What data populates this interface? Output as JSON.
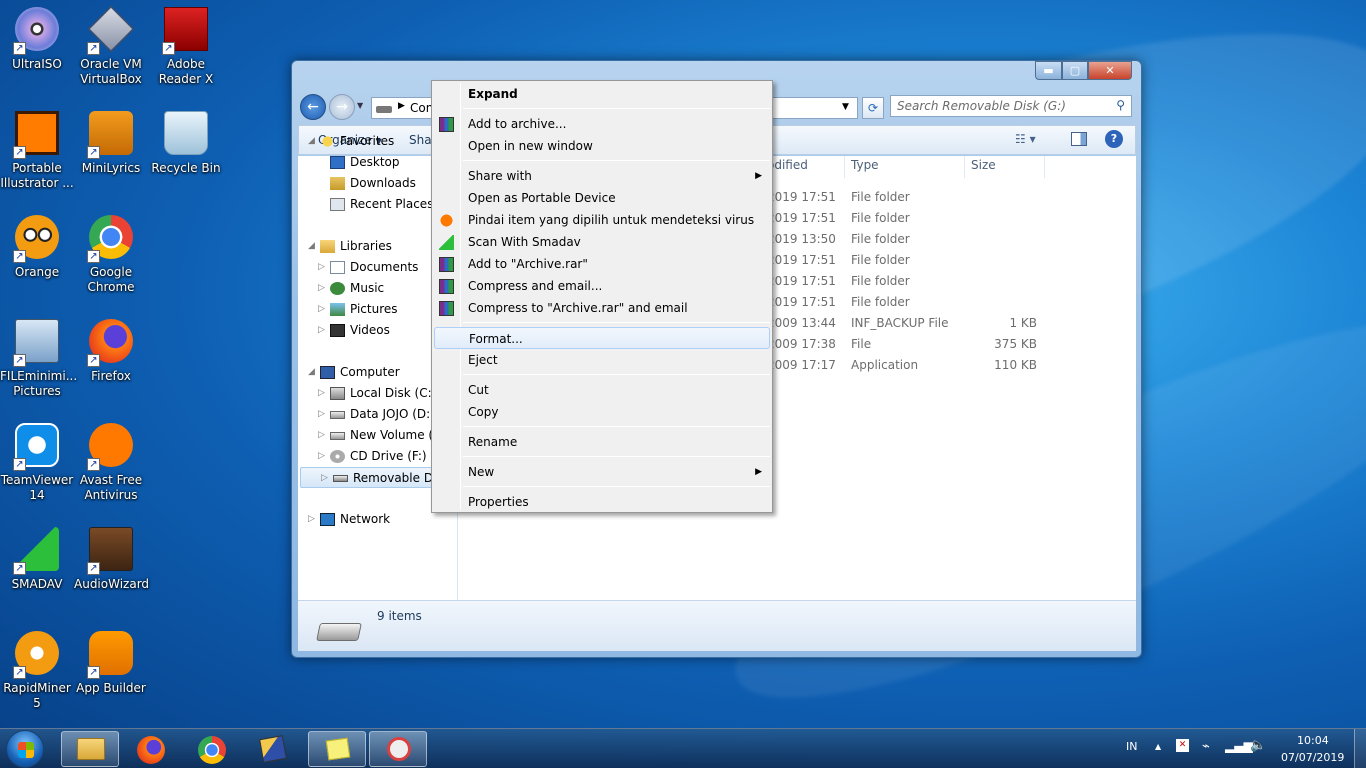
{
  "desktop": {
    "icons": [
      {
        "label": "UltraISO",
        "icon": "ultraiso-disc-icon"
      },
      {
        "label": "Oracle VM VirtualBox",
        "icon": "virtualbox-icon"
      },
      {
        "label": "Adobe Reader X",
        "icon": "adobe-reader-icon"
      },
      {
        "label": "Portable Illustrator ...",
        "icon": "illustrator-icon"
      },
      {
        "label": "MiniLyrics",
        "icon": "minilyrics-icon"
      },
      {
        "label": "Recycle Bin",
        "icon": "recycle-bin-icon"
      },
      {
        "label": "Orange",
        "icon": "orange-app-icon"
      },
      {
        "label": "Google Chrome",
        "icon": "chrome-icon"
      },
      {
        "label": "FILEminimi... Pictures",
        "icon": "fileminimizer-icon"
      },
      {
        "label": "Firefox",
        "icon": "firefox-icon"
      },
      {
        "label": "TeamViewer 14",
        "icon": "teamviewer-icon"
      },
      {
        "label": "Avast Free Antivirus",
        "icon": "avast-icon"
      },
      {
        "label": "SMADAV",
        "icon": "smadav-icon"
      },
      {
        "label": "AudioWizard",
        "icon": "audiowizard-icon"
      },
      {
        "label": "RapidMiner 5",
        "icon": "rapidminer-icon"
      },
      {
        "label": "App Builder",
        "icon": "app-builder-icon"
      }
    ]
  },
  "explorer": {
    "address_visible": "Com",
    "search_placeholder": "Search Removable Disk (G:)",
    "toolbar": {
      "organize": "Organize",
      "share": "Share"
    },
    "nav": [
      {
        "label": "Favorites",
        "icon": "star-icon",
        "level": 0,
        "expander": "open"
      },
      {
        "label": "Desktop",
        "icon": "desktop-icon",
        "level": 1
      },
      {
        "label": "Downloads",
        "icon": "downloads-icon",
        "level": 1
      },
      {
        "label": "Recent Places",
        "icon": "recent-places-icon",
        "level": 1
      },
      {
        "label": "Libraries",
        "icon": "libraries-icon",
        "level": 0,
        "expander": "open"
      },
      {
        "label": "Documents",
        "icon": "documents-icon",
        "level": 1,
        "expander": "closed"
      },
      {
        "label": "Music",
        "icon": "music-icon",
        "level": 1,
        "expander": "closed"
      },
      {
        "label": "Pictures",
        "icon": "pictures-icon",
        "level": 1,
        "expander": "closed"
      },
      {
        "label": "Videos",
        "icon": "videos-icon",
        "level": 1,
        "expander": "closed"
      },
      {
        "label": "Computer",
        "icon": "computer-icon",
        "level": 0,
        "expander": "open"
      },
      {
        "label": "Local Disk (C:)",
        "icon": "local-disk-icon",
        "level": 1,
        "expander": "closed"
      },
      {
        "label": "Data JOJO (D:)",
        "icon": "drive-icon",
        "level": 1,
        "expander": "closed"
      },
      {
        "label": "New Volume (E:",
        "icon": "drive-icon",
        "level": 1,
        "expander": "closed"
      },
      {
        "label": "CD Drive (F:)",
        "icon": "cd-drive-icon",
        "level": 1,
        "expander": "closed"
      },
      {
        "label": "Removable Disk (G:)",
        "icon": "removable-disk-icon",
        "level": 1,
        "expander": "closed",
        "selected": true
      },
      {
        "label": "Network",
        "icon": "network-icon",
        "level": 0,
        "expander": "closed"
      }
    ],
    "columns": {
      "modified": "odified",
      "type": "Type",
      "size": "Size"
    },
    "rows": [
      {
        "modified": "2019 17:51",
        "type": "File folder",
        "size": ""
      },
      {
        "modified": "2019 17:51",
        "type": "File folder",
        "size": ""
      },
      {
        "modified": "2019 13:50",
        "type": "File folder",
        "size": ""
      },
      {
        "modified": "2019 17:51",
        "type": "File folder",
        "size": ""
      },
      {
        "modified": "2019 17:51",
        "type": "File folder",
        "size": ""
      },
      {
        "modified": "2019 17:51",
        "type": "File folder",
        "size": ""
      },
      {
        "modified": "2009 13:44",
        "type": "INF_BACKUP File",
        "size": "1 KB"
      },
      {
        "modified": "2009 17:38",
        "type": "File",
        "size": "375 KB"
      },
      {
        "modified": "2009 17:17",
        "type": "Application",
        "size": "110 KB"
      }
    ],
    "status": "9 items"
  },
  "context_menu": {
    "items": [
      {
        "label": "Expand",
        "bold": true,
        "icon": ""
      },
      {
        "sep": true
      },
      {
        "label": "Add to archive...",
        "icon": "winrar-icon"
      },
      {
        "label": "Open in new window",
        "icon": ""
      },
      {
        "sep": true
      },
      {
        "label": "Share with",
        "icon": "",
        "submenu": true
      },
      {
        "label": "Open as Portable Device",
        "icon": ""
      },
      {
        "label": "Pindai item yang dipilih untuk mendeteksi virus",
        "icon": "avast-icon"
      },
      {
        "label": "Scan With Smadav",
        "icon": "smadav-icon"
      },
      {
        "label": "Add to \"Archive.rar\"",
        "icon": "winrar-icon"
      },
      {
        "label": "Compress and email...",
        "icon": "winrar-icon"
      },
      {
        "label": "Compress to \"Archive.rar\" and email",
        "icon": "winrar-icon"
      },
      {
        "sep": true
      },
      {
        "label": "Format...",
        "icon": "",
        "highlight": true
      },
      {
        "label": "Eject",
        "icon": ""
      },
      {
        "sep": true
      },
      {
        "label": "Cut",
        "icon": ""
      },
      {
        "label": "Copy",
        "icon": ""
      },
      {
        "sep": true
      },
      {
        "label": "Rename",
        "icon": ""
      },
      {
        "sep": true
      },
      {
        "label": "New",
        "icon": "",
        "submenu": true
      },
      {
        "sep": true
      },
      {
        "label": "Properties",
        "icon": ""
      }
    ]
  },
  "taskbar": {
    "items": [
      {
        "icon": "start-orb-icon"
      },
      {
        "icon": "windows-explorer-icon",
        "active": true
      },
      {
        "icon": "firefox-icon"
      },
      {
        "icon": "chrome-icon"
      },
      {
        "icon": "network-tool-icon"
      },
      {
        "icon": "sticky-notes-icon"
      },
      {
        "icon": "snipping-tool-icon"
      }
    ],
    "lang": "IN",
    "time": "10:04",
    "date": "07/07/2019"
  }
}
